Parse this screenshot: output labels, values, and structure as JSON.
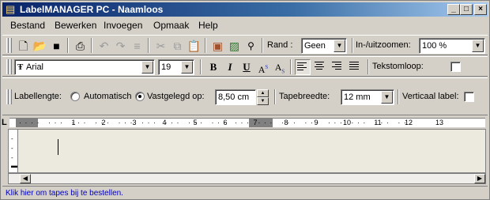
{
  "window": {
    "title": "LabelMANAGER PC - Naamloos",
    "buttons": {
      "minimize": "_",
      "maximize": "□",
      "close": "×"
    }
  },
  "menu": {
    "items": [
      {
        "label": "Bestand"
      },
      {
        "label": "Bewerken"
      },
      {
        "label": "Invoegen"
      },
      {
        "label": "Opmaak"
      },
      {
        "label": "Help"
      }
    ]
  },
  "toolbar1": {
    "icons": [
      "new-icon",
      "open-icon",
      "save-icon",
      "print-icon",
      "undo-icon",
      "redo-icon",
      "format-icon",
      "cut-icon",
      "copy-icon",
      "paste-icon",
      "insert-image-icon",
      "clipart-icon",
      "symbols-icon"
    ],
    "border_label": "Rand :",
    "border_value": "Geen",
    "zoom_label": "In-/uitzoomen:",
    "zoom_value": "100 %"
  },
  "toolbar2": {
    "font_value": "Arial",
    "font_icon": "Ŧ",
    "size_value": "19",
    "bold": "B",
    "italic": "I",
    "underline": "U",
    "superscript": "A",
    "superscript_mark": "S",
    "subscript": "A",
    "subscript_mark": "S",
    "wrap_label": "Tekstomloop:",
    "wrap_checked": false
  },
  "toolbar3": {
    "length_label": "Labellengte:",
    "auto_label": "Automatisch",
    "fixed_label": "Vastgelegd op:",
    "fixed_selected": true,
    "length_value": "8,50 cm",
    "tape_label": "Tapebreedte:",
    "tape_value": "12 mm",
    "vertical_label": "Verticaal label:",
    "vertical_checked": false
  },
  "ruler": {
    "corner": "L",
    "numbers": [
      "1",
      "2",
      "3",
      "4",
      "5",
      "6",
      "7",
      "8",
      "9",
      "10",
      "11",
      "12",
      "13"
    ]
  },
  "status": {
    "text": "Klik hier om tapes bij te bestellen."
  }
}
